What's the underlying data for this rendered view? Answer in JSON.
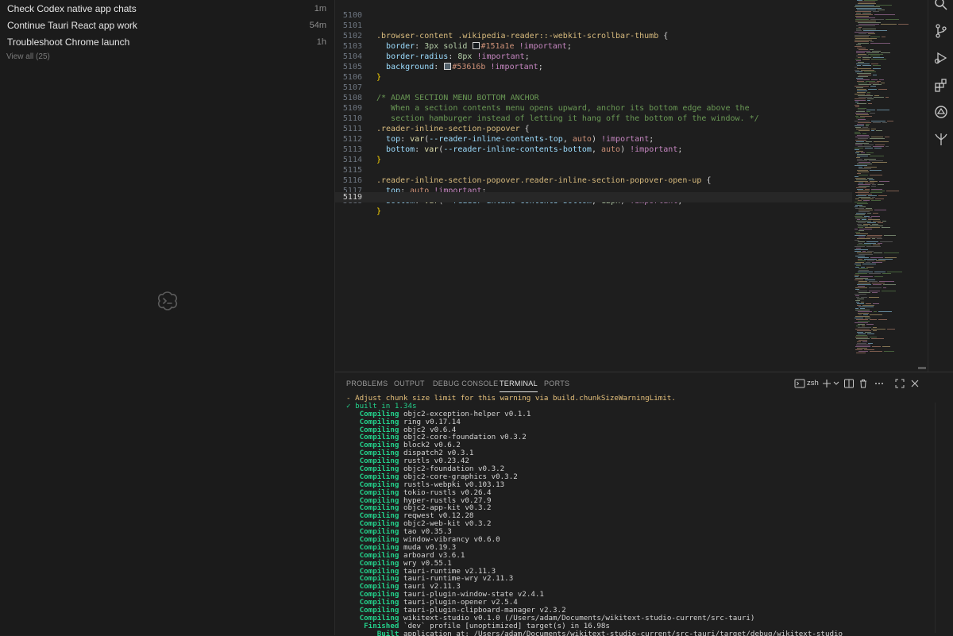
{
  "sidebar": {
    "chats": [
      {
        "title": "Check Codex native app chats",
        "time": "1m"
      },
      {
        "title": "Continue Tauri React app work",
        "time": "54m"
      },
      {
        "title": "Troubleshoot Chrome launch",
        "time": "1h"
      }
    ],
    "view_all": "View all (25)"
  },
  "editor": {
    "line_numbers": [
      "5100",
      "5101",
      "5102",
      "5103",
      "5104",
      "5105",
      "5106",
      "5107",
      "5108",
      "5109",
      "5110",
      "5111",
      "5112",
      "5113",
      "5114",
      "5115",
      "5116",
      "5117",
      "5118",
      "5119"
    ],
    "current_line": "5119",
    "swatch_colors": {
      "first": "#151a1e",
      "second": "#53616b"
    }
  },
  "code": {
    "l5101_sel": ".browser-content .wikipedia-reader::-webkit-scrollbar-thumb",
    "brace_open": "{",
    "brace_close": "}",
    "l5102_prop": "border",
    "l5102_val": "3px solid",
    "l5102_color": "#151a1e",
    "important": "!important",
    "l5103_prop": "border-radius",
    "l5103_val": "8px",
    "l5104_prop": "background",
    "l5104_color": "#53616b",
    "l5107": "/* ADAM SECTION MENU BOTTOM ANCHOR",
    "l5108": "   When a section contents menu opens upward, anchor its bottom edge above the",
    "l5109": "   section hamburger instead of letting it hang off the bottom of the window. */",
    "l5110_sel": ".reader-inline-section-popover",
    "l5111_prop": "top",
    "var_fn": "var",
    "l5111_var": "--reader-inline-contents-top",
    "auto": "auto",
    "l5112_prop": "bottom",
    "l5112_var": "--reader-inline-contents-bottom",
    "l5115_sel": ".reader-inline-section-popover.reader-inline-section-popover-open-up",
    "l5116_prop": "top",
    "l5117_prop": "bottom",
    "l5117_var": "--reader-inline-contents-bottom",
    "l5117_px": "12px"
  },
  "activity_bar": {
    "icons": [
      "search-icon",
      "source-control-icon",
      "run-debug-icon",
      "extensions-icon",
      "codex-icon",
      "tree-icon"
    ]
  },
  "panel": {
    "tabs": [
      "PROBLEMS",
      "OUTPUT",
      "DEBUG CONSOLE",
      "TERMINAL",
      "PORTS"
    ],
    "active_tab": "TERMINAL",
    "shell": "zsh"
  },
  "terminal": {
    "warn_line": "- Adjust chunk size limit for this warning via build.chunkSizeWarningLimit.",
    "built_line": "✓ built in 1.34s",
    "compiling_verb": "Compiling",
    "compiling": [
      "objc2-exception-helper v0.1.1",
      "ring v0.17.14",
      "objc2 v0.6.4",
      "objc2-core-foundation v0.3.2",
      "block2 v0.6.2",
      "dispatch2 v0.3.1",
      "rustls v0.23.42",
      "objc2-foundation v0.3.2",
      "objc2-core-graphics v0.3.2",
      "rustls-webpki v0.103.13",
      "tokio-rustls v0.26.4",
      "hyper-rustls v0.27.9",
      "objc2-app-kit v0.3.2",
      "reqwest v0.12.28",
      "objc2-web-kit v0.3.2",
      "tao v0.35.3",
      "window-vibrancy v0.6.0",
      "muda v0.19.3",
      "arboard v3.6.1",
      "wry v0.55.1",
      "tauri-runtime v2.11.3",
      "tauri-runtime-wry v2.11.3",
      "tauri v2.11.3",
      "tauri-plugin-window-state v2.4.1",
      "tauri-plugin-opener v2.5.4",
      "tauri-plugin-clipboard-manager v2.3.2",
      "wikitext-studio v0.1.0 (/Users/adam/Documents/wikitext-studio-current/src-tauri)"
    ],
    "finished_verb": "Finished",
    "finished_text": "`dev` profile [unoptimized] target(s) in 16.98s",
    "built_verb": "Built",
    "built_text": "application at: /Users/adam/Documents/wikitext-studio-current/src-tauri/target/debug/wikitext-studio"
  }
}
